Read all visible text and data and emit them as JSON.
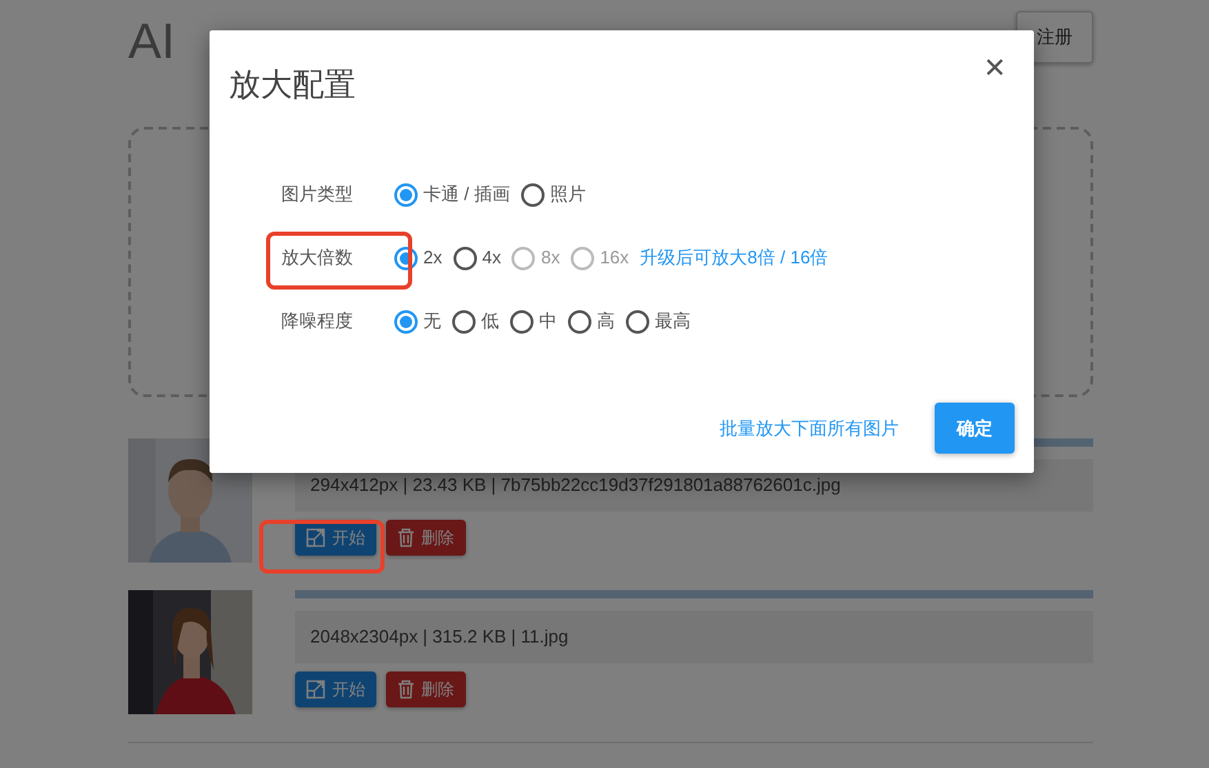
{
  "page": {
    "title": "AI",
    "register_button": "注册"
  },
  "files": [
    {
      "progress": {
        "level": 1
      },
      "info": "294x412px | 23.43 KB | 7b75bb22cc19d37f291801a88762601c.jpg",
      "start": "开始",
      "delete": "删除",
      "highlighted": true
    },
    {
      "progress": {
        "level": 1
      },
      "info": "2048x2304px | 315.2 KB | 11.jpg",
      "start": "开始",
      "delete": "删除",
      "highlighted": false
    }
  ],
  "dialog": {
    "title": "放大配置",
    "close": "✕",
    "groups": [
      {
        "label": "图片类型",
        "highlighted": false,
        "options": [
          {
            "label": "卡通 / 插画",
            "selected": true,
            "disabled": false
          },
          {
            "label": "照片",
            "selected": false,
            "disabled": false
          }
        ]
      },
      {
        "label": "放大倍数",
        "highlighted": true,
        "options": [
          {
            "label": "2x",
            "selected": true,
            "disabled": false
          },
          {
            "label": "4x",
            "selected": false,
            "disabled": false
          },
          {
            "label": "8x",
            "selected": false,
            "disabled": true
          },
          {
            "label": "16x",
            "selected": false,
            "disabled": true
          }
        ],
        "link": "升级后可放大8倍 / 16倍"
      },
      {
        "label": "降噪程度",
        "highlighted": false,
        "options": [
          {
            "label": "无",
            "selected": true,
            "disabled": false
          },
          {
            "label": "低",
            "selected": false,
            "disabled": false
          },
          {
            "label": "中",
            "selected": false,
            "disabled": false
          },
          {
            "label": "高",
            "selected": false,
            "disabled": false
          },
          {
            "label": "最高",
            "selected": false,
            "disabled": false
          }
        ]
      }
    ],
    "batch_link": "批量放大下面所有图片",
    "confirm": "确定"
  }
}
